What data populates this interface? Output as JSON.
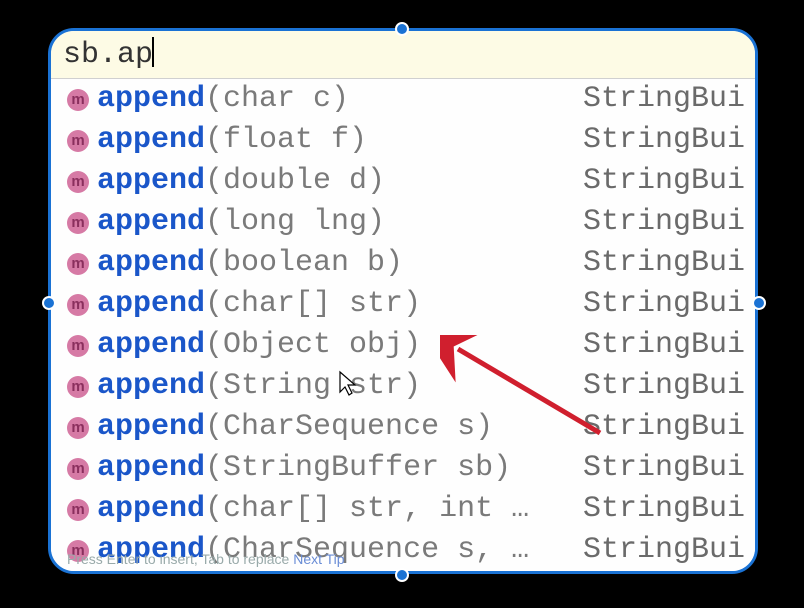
{
  "input": {
    "text": "sb.ap"
  },
  "badge": "m",
  "colors": {
    "selection_border": "#1a72d4",
    "method_name": "#1a56c9",
    "badge_bg": "#d67aa5",
    "annotation_arrow": "#d01f2e"
  },
  "suggestions": [
    {
      "match": "ap",
      "tail": "pend",
      "params": "(char c)",
      "return": "StringBui"
    },
    {
      "match": "ap",
      "tail": "pend",
      "params": "(float f)",
      "return": "StringBui"
    },
    {
      "match": "ap",
      "tail": "pend",
      "params": "(double d)",
      "return": "StringBui"
    },
    {
      "match": "ap",
      "tail": "pend",
      "params": "(long lng)",
      "return": "StringBui"
    },
    {
      "match": "ap",
      "tail": "pend",
      "params": "(boolean b)",
      "return": "StringBui"
    },
    {
      "match": "ap",
      "tail": "pend",
      "params": "(char[] str)",
      "return": "StringBui"
    },
    {
      "match": "ap",
      "tail": "pend",
      "params": "(Object obj)",
      "return": "StringBui"
    },
    {
      "match": "ap",
      "tail": "pend",
      "params": "(String str)",
      "return": "StringBui"
    },
    {
      "match": "ap",
      "tail": "pend",
      "params": "(CharSequence s)",
      "return": "StringBui"
    },
    {
      "match": "ap",
      "tail": "pend",
      "params": "(StringBuffer sb)",
      "return": "StringBui"
    },
    {
      "match": "ap",
      "tail": "pend",
      "params": "(char[] str, int …",
      "return": "StringBui"
    },
    {
      "match": "ap",
      "tail": "pend",
      "params": "(CharSequence s, …",
      "return": "StringBui"
    }
  ],
  "footer": {
    "hint": "Press Enter to insert, Tab to replace",
    "link": "Next Tip"
  }
}
